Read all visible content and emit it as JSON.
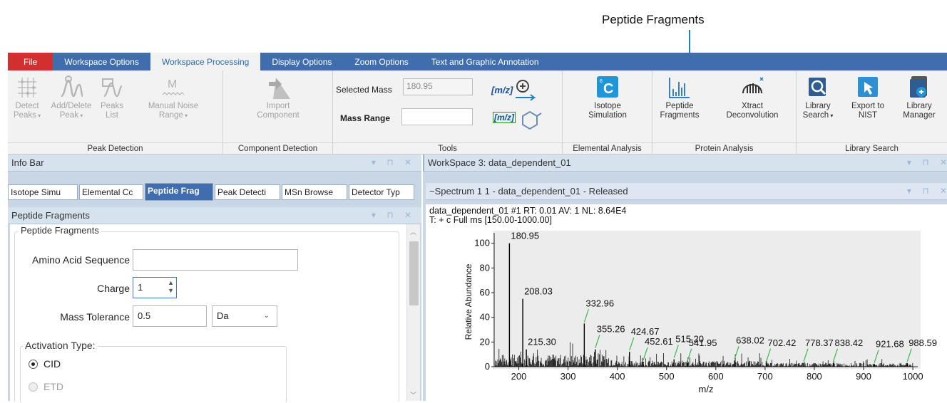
{
  "callout": "Peptide Fragments",
  "tabs": [
    "File",
    "Workspace Options",
    "Workspace Processing",
    "Display Options",
    "Zoom Options",
    "Text and Graphic Annotation"
  ],
  "groups": {
    "peak_detection": "Peak Detection",
    "component_detection": "Component Detection",
    "tools": "Tools",
    "elemental_analysis": "Elemental Analysis",
    "protein_analysis": "Protein Analysis",
    "library_search": "Library Search"
  },
  "buttons": {
    "detect_peaks": [
      "Detect",
      "Peaks"
    ],
    "add_delete_peak": [
      "Add/Delete",
      "Peak"
    ],
    "peaks_list": [
      "Peaks",
      "List"
    ],
    "manual_noise": [
      "Manual Noise",
      "Range"
    ],
    "import_component": [
      "Import",
      "Component"
    ],
    "isotope_simulation": [
      "Isotope",
      "Simulation"
    ],
    "peptide_fragments": [
      "Peptide",
      "Fragments"
    ],
    "xtract": [
      "Xtract",
      "Deconvolution"
    ],
    "library_search": [
      "Library",
      "Search"
    ],
    "export_nist": [
      "Export to",
      "NIST"
    ],
    "library_manager": [
      "Library",
      "Manager"
    ]
  },
  "tools": {
    "selected_mass_label": "Selected Mass",
    "selected_mass_value": "180.95",
    "mass_range_label": "Mass Range",
    "mass_range_value": "",
    "mz_label": "[m/z]"
  },
  "info_bar": {
    "title": "Info Bar",
    "tabs": [
      "Isotope Simu",
      "Elemental Cc",
      "Peptide Frag",
      "Peak Detecti",
      "MSn Browse",
      "Detector Typ"
    ],
    "active_tab": 2
  },
  "peptide_panel": {
    "title": "Peptide Fragments",
    "group_title": "Peptide Fragments",
    "aa_label": "Amino Acid Sequence",
    "aa_value": "",
    "charge_label": "Charge",
    "charge_value": "1",
    "tol_label": "Mass Tolerance",
    "tol_value": "0.5",
    "unit_value": "Da",
    "activation_label": "Activation Type:",
    "activation_options": [
      "CID",
      "ETD"
    ],
    "activation_selected": "CID"
  },
  "workspace": {
    "title": "WorkSpace 3: data_dependent_01",
    "spectrum_title": "~Spectrum  1  1 - data_dependent_01 - Released",
    "header_line1": "data_dependent_01 #1 RT: 0.01 AV: 1 NL: 8.64E4",
    "header_line2": "T: + c Full ms [150.00-1000.00]"
  },
  "chart_data": {
    "type": "bar",
    "title": "",
    "xlabel": "m/z",
    "ylabel": "Relative Abundance",
    "xlim": [
      150,
      1010
    ],
    "ylim": [
      0,
      105
    ],
    "xticks": [
      200,
      300,
      400,
      500,
      600,
      700,
      800,
      900,
      1000
    ],
    "yticks": [
      0,
      20,
      40,
      60,
      80,
      100
    ],
    "labeled_peaks": [
      {
        "mz": 180.95,
        "y": 100,
        "label": "180.95"
      },
      {
        "mz": 208.03,
        "y": 55,
        "label": "208.03"
      },
      {
        "mz": 215.3,
        "y": 14,
        "label": "215.30"
      },
      {
        "mz": 332.96,
        "y": 35,
        "label": "332.96"
      },
      {
        "mz": 355.26,
        "y": 14,
        "label": "355.26"
      },
      {
        "mz": 424.67,
        "y": 12,
        "label": "424.67"
      },
      {
        "mz": 452.61,
        "y": 4,
        "label": "452.61"
      },
      {
        "mz": 515.2,
        "y": 6,
        "label": "515.20"
      },
      {
        "mz": 541.95,
        "y": 3,
        "label": "541.95"
      },
      {
        "mz": 638.02,
        "y": 5,
        "label": "638.02"
      },
      {
        "mz": 702.42,
        "y": 3,
        "label": "702.42"
      },
      {
        "mz": 778.37,
        "y": 3,
        "label": "778.37"
      },
      {
        "mz": 838.42,
        "y": 3,
        "label": "838.42"
      },
      {
        "mz": 921.68,
        "y": 2,
        "label": "921.68"
      },
      {
        "mz": 988.59,
        "y": 3,
        "label": "988.59"
      }
    ]
  }
}
